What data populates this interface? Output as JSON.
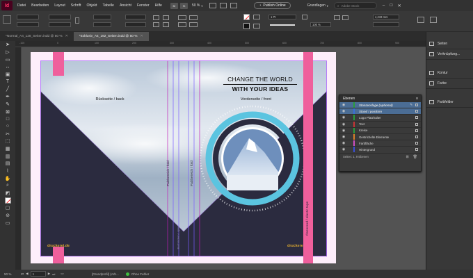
{
  "app": {
    "logo_text": "Id",
    "menus": [
      "Datei",
      "Bearbeiten",
      "Layout",
      "Schrift",
      "Objekt",
      "Tabelle",
      "Ansicht",
      "Fenster",
      "Hilfe"
    ],
    "zoom": "50 %",
    "publish_label": "Publish Online",
    "workspace": "Grundlagen",
    "search_placeholder": "Adobe Stock"
  },
  "control_bar": {
    "stroke_weight": "1 Pt",
    "opacity": "100 %",
    "dimension": "4,233 mm",
    "color_accent": "#ff2b2b"
  },
  "tabs": [
    {
      "label": "*Normal_A4_128_Seiten.indd @ 50 %"
    },
    {
      "label": "*Exklusiv_A4_192_Seiten.indd @ 50 %"
    }
  ],
  "ruler": {
    "ticks": [
      "-100",
      "0",
      "100",
      "200",
      "300",
      "400",
      "500",
      "600",
      "700",
      "800",
      "900"
    ]
  },
  "document": {
    "back_label": "Rückseite / back",
    "front_label": "Vorderseite / front",
    "headline_1": "CHANGE THE WORLD",
    "headline_2": "WITH YOUR IDEAS",
    "spine_label_1": "Falzbereich / fold",
    "spine_label_2": "Falzbereich / fold",
    "spine_label_3": "Buchrücken / spine",
    "strip_label": "Ösenrand / elastic tape",
    "brand_left": "druckerei.de",
    "brand_right": "druckerei.de",
    "colors": {
      "pink": "#ef5f9c",
      "dark": "#2b2b3f",
      "cyan": "#5bc4e0"
    }
  },
  "panels": {
    "items": [
      "Seiten",
      "Verknüpfung...",
      "Kontur",
      "Farbe",
      "Farbfelder"
    ]
  },
  "layers": {
    "title": "Ebenen",
    "rows": [
      {
        "name": "Stanzvorlage (optional)",
        "color": "#2a9d3c",
        "selected": true
      },
      {
        "name": "Stand / position",
        "color": "#3a6fd8",
        "selected": true
      },
      {
        "name": "Logo Platzhalter",
        "color": "#2a9d3c",
        "selected": false
      },
      {
        "name": "Text",
        "color": "#c93434",
        "selected": false
      },
      {
        "name": "Kreise",
        "color": "#2a9d3c",
        "selected": false
      },
      {
        "name": "Gestrichelte Elemente",
        "color": "#d9802a",
        "selected": false
      },
      {
        "name": "Farbfläche",
        "color": "#d04fc4",
        "selected": false
      },
      {
        "name": "Hintergrund",
        "color": "#3a4fd8",
        "selected": false
      }
    ],
    "footer": "Seiten: 1, 9 Ebenen"
  },
  "status": {
    "page": "1",
    "preflight_profile": "[Grundprofil] (Arb...",
    "errors": "Ohne Fehler"
  }
}
